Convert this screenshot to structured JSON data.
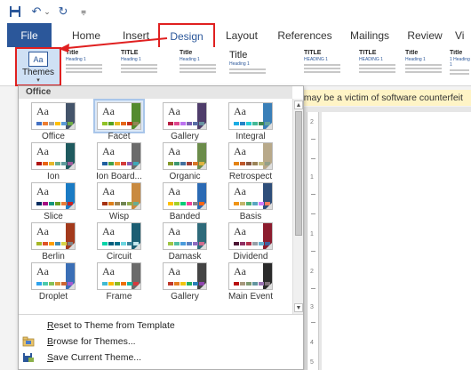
{
  "colors": {
    "brand": "#2b579a",
    "highlight_border": "#e02020",
    "selected_tile": "#dce8f6",
    "notice_bg": "#fff4c6"
  },
  "qat": {
    "save_icon": "save-icon",
    "undo_icon": "undo-icon",
    "undo_dropdown_icon": "chevron-down-icon",
    "redo_icon": "redo-icon",
    "customize_icon": "customize-qat-icon",
    "undo_glyph": "↶",
    "undo_more_glyph": "⌄",
    "redo_glyph": "↻",
    "customize_glyph": "⩦"
  },
  "tabs": [
    "File",
    "Home",
    "Insert",
    "Design",
    "Layout",
    "References",
    "Mailings",
    "Review",
    "Vi"
  ],
  "ribbon": {
    "themes_label": "Themes",
    "themes_icon_text": "Aa",
    "document_formatting": [
      {
        "title": "Title",
        "heading": "Heading 1"
      },
      {
        "title": "TITLE",
        "heading": "Heading 1"
      },
      {
        "title": "Title",
        "heading": "Heading 1"
      },
      {
        "title": "Title",
        "heading": "Heading 1"
      },
      {
        "title": "TITLE",
        "heading": "HEADING 1"
      },
      {
        "title": "TITLE",
        "heading": "HEADING 1"
      },
      {
        "title": "Title",
        "heading": "Heading 1"
      },
      {
        "title": "Title",
        "heading": "1 Heading 1"
      }
    ]
  },
  "notice": "u may be a victim of software counterfeit",
  "ruler_marks": [
    "2",
    "1",
    "1",
    "2",
    "3",
    "4",
    "5"
  ],
  "gallery": {
    "heading": "Office",
    "sample_text": "Aa",
    "themes": [
      {
        "name": "Office",
        "accent": "#4472c4",
        "side": "#44546a",
        "colors": [
          "#4472c4",
          "#ed7d31",
          "#a5a5a5",
          "#ffc000",
          "#5b9bd5",
          "#70ad47"
        ],
        "selected": false
      },
      {
        "name": "Facet",
        "accent": "#90c226",
        "side": "#548b2e",
        "colors": [
          "#90c226",
          "#54a021",
          "#e6b91e",
          "#e76618",
          "#c42f1a",
          "#918655"
        ],
        "selected": true
      },
      {
        "name": "Gallery",
        "accent": "#b71e42",
        "side": "#4f3d6b",
        "colors": [
          "#b71e42",
          "#de478e",
          "#bc72f0",
          "#795faf",
          "#586ea6",
          "#6892a0"
        ],
        "selected": false
      },
      {
        "name": "Integral",
        "accent": "#1cade4",
        "side": "#3a7fb8",
        "colors": [
          "#1cade4",
          "#2683c6",
          "#27ced7",
          "#42ba97",
          "#3e8853",
          "#62a39f"
        ],
        "selected": false
      },
      {
        "name": "Ion",
        "accent": "#b01513",
        "side": "#1f5a5f",
        "colors": [
          "#b01513",
          "#ea6312",
          "#e6b729",
          "#6aac90",
          "#5f9c9d",
          "#9e5e9b"
        ],
        "selected": false
      },
      {
        "name": "Ion Board...",
        "accent": "#1e5e9f",
        "side": "#6b6b6b",
        "colors": [
          "#1e5e9f",
          "#43a046",
          "#ef9b2f",
          "#d43c3c",
          "#8a5ab0",
          "#3fa6b7"
        ],
        "selected": false
      },
      {
        "name": "Organic",
        "accent": "#83992a",
        "side": "#6b8c4a",
        "colors": [
          "#83992a",
          "#3c9770",
          "#44709d",
          "#a23c33",
          "#d97828",
          "#deb340"
        ],
        "selected": false
      },
      {
        "name": "Retrospect",
        "accent": "#e48312",
        "side": "#b8a98a",
        "colors": [
          "#e48312",
          "#bd582c",
          "#865640",
          "#9b8357",
          "#c2bc80",
          "#94a088"
        ],
        "selected": false
      },
      {
        "name": "Slice",
        "accent": "#052f61",
        "side": "#1a7bc4",
        "colors": [
          "#052f61",
          "#a50e82",
          "#14967c",
          "#6a9e1f",
          "#e87d37",
          "#c62324"
        ],
        "selected": false
      },
      {
        "name": "Wisp",
        "accent": "#a53010",
        "side": "#c98a40",
        "colors": [
          "#a53010",
          "#de7e18",
          "#9f8351",
          "#728653",
          "#92aa4c",
          "#6aac91"
        ],
        "selected": false
      },
      {
        "name": "Banded",
        "accent": "#ffc000",
        "side": "#2b6ab4",
        "colors": [
          "#ffc000",
          "#a5d028",
          "#08cc78",
          "#f24099",
          "#828288",
          "#f56617"
        ],
        "selected": false
      },
      {
        "name": "Basis",
        "accent": "#f09415",
        "side": "#2e4e7a",
        "colors": [
          "#f09415",
          "#c1b56b",
          "#4baf73",
          "#5aa6c0",
          "#d17df9",
          "#fa7e5c"
        ],
        "selected": false
      },
      {
        "name": "Berlin",
        "accent": "#a6b727",
        "side": "#a33a1c",
        "colors": [
          "#a6b727",
          "#df5327",
          "#fe9e00",
          "#418ab3",
          "#d7d447",
          "#818183"
        ],
        "selected": false
      },
      {
        "name": "Circuit",
        "accent": "#03d4a8",
        "side": "#1c5e73",
        "colors": [
          "#03d4a8",
          "#005e7e",
          "#026f8a",
          "#6dd6e0",
          "#3a8299",
          "#c3e6ec"
        ],
        "selected": false
      },
      {
        "name": "Damask",
        "accent": "#9ec544",
        "side": "#2e6a7a",
        "colors": [
          "#9ec544",
          "#50bea3",
          "#4a9bdc",
          "#5a80c0",
          "#8d6bc0",
          "#cf6c8e"
        ],
        "selected": false
      },
      {
        "name": "Dividend",
        "accent": "#4d1434",
        "side": "#8c1c2e",
        "colors": [
          "#4d1434",
          "#903163",
          "#b2324b",
          "#969fa7",
          "#66b1ce",
          "#40619d"
        ],
        "selected": false
      },
      {
        "name": "Droplet",
        "accent": "#2fa3ee",
        "side": "#3b6fb6",
        "colors": [
          "#2fa3ee",
          "#4bcaad",
          "#86c157",
          "#d99c3f",
          "#ce6633",
          "#a35dd1"
        ],
        "selected": false
      },
      {
        "name": "Frame",
        "accent": "#40bad2",
        "side": "#6b6b6b",
        "colors": [
          "#40bad2",
          "#fab900",
          "#90bb23",
          "#ee7008",
          "#1ab39f",
          "#d5393d"
        ],
        "selected": false
      },
      {
        "name": "Gallery",
        "accent": "#c0392b",
        "side": "#444444",
        "colors": [
          "#c0392b",
          "#e67e22",
          "#f1c40f",
          "#27ae60",
          "#2980b9",
          "#8e44ad"
        ],
        "selected": false
      },
      {
        "name": "Main Event",
        "accent": "#b80e0f",
        "side": "#2a2a2a",
        "colors": [
          "#b80e0f",
          "#a6987d",
          "#7f9a71",
          "#64969f",
          "#9b75b2",
          "#80737a"
        ],
        "selected": false
      }
    ]
  },
  "menu": {
    "reset_label": "Reset to Theme from Template",
    "reset_hotkey": "R",
    "reset_rest": "eset to Theme from Template",
    "browse_hotkey": "B",
    "browse_rest": "rowse for Themes...",
    "save_prefix": "",
    "save_hotkey": "S",
    "save_rest": "ave Current Theme..."
  }
}
